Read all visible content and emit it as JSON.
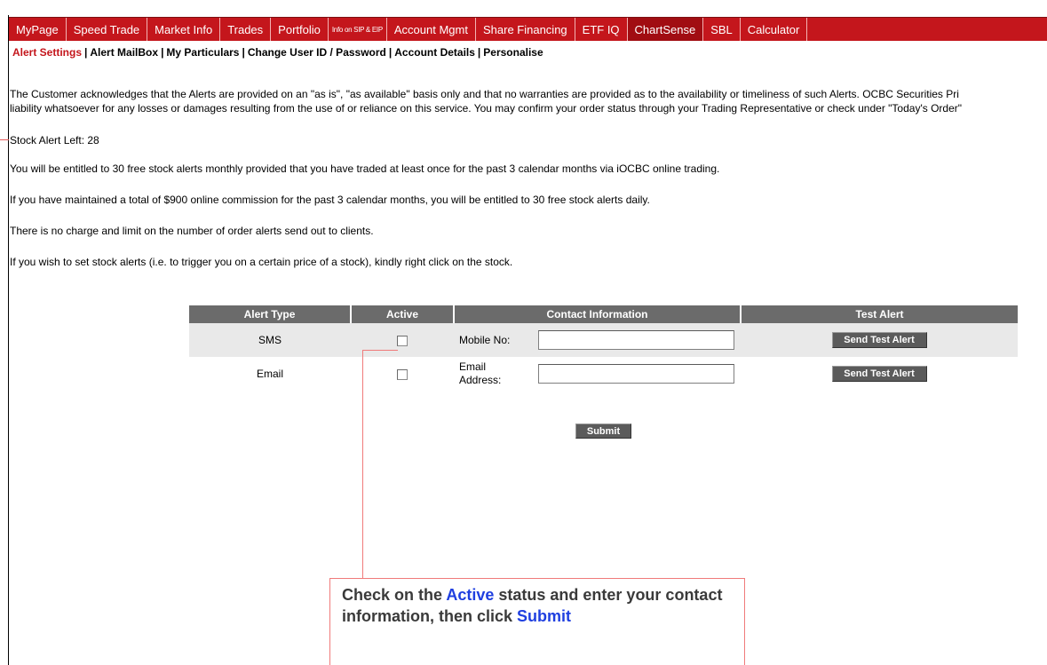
{
  "topnav": [
    {
      "label": "MyPage",
      "style": "normal"
    },
    {
      "label": "Speed Trade",
      "style": "normal"
    },
    {
      "label": "Market Info",
      "style": "normal"
    },
    {
      "label": "Trades",
      "style": "normal"
    },
    {
      "label": "Portfolio",
      "style": "normal"
    },
    {
      "label": "Info on SIP & EIP",
      "style": "tiny"
    },
    {
      "label": "Account Mgmt",
      "style": "normal"
    },
    {
      "label": "Share Financing",
      "style": "normal"
    },
    {
      "label": "ETF IQ",
      "style": "normal"
    },
    {
      "label": "ChartSense",
      "style": "dark"
    },
    {
      "label": "SBL",
      "style": "normal"
    },
    {
      "label": "Calculator",
      "style": "normal"
    }
  ],
  "subnav": [
    {
      "label": "Alert Settings",
      "active": true
    },
    {
      "label": "Alert MailBox",
      "active": false
    },
    {
      "label": "My Particulars",
      "active": false
    },
    {
      "label": "Change User ID / Password",
      "active": false
    },
    {
      "label": "Account Details",
      "active": false
    },
    {
      "label": "Personalise",
      "active": false
    }
  ],
  "subnav_separator": "|",
  "disclaimer": {
    "line1": "The Customer acknowledges that the Alerts are provided on an \"as is\", \"as available\" basis only and that no warranties are provided as to the availability or timeliness of such Alerts. OCBC Securities Pri",
    "line2": "liability whatsoever for any losses or damages resulting from the use of or reliance on this service. You may confirm your order status through your Trading Representative or check under \"Today's Order\""
  },
  "stock_alert_left": "Stock Alert Left: 28",
  "info": {
    "monthly": "You will be entitled to 30 free stock alerts monthly provided that you have traded at least once for the past 3 calendar months via iOCBC online trading.",
    "daily": "If you have maintained a total of $900 online commission for the past 3 calendar months, you will be entitled to 30 free stock alerts daily.",
    "order_alerts": "There is no charge and limit on the number of order alerts send out to clients.",
    "right_click": "If you wish to set stock alerts (i.e. to trigger you on a certain price of a stock), kindly right click on the stock."
  },
  "alerts_table": {
    "headers": {
      "alert_type": "Alert Type",
      "active": "Active",
      "contact": "Contact Information",
      "test": "Test Alert"
    },
    "rows": {
      "sms": {
        "type": "SMS",
        "active": false,
        "contact_label": "Mobile No:",
        "contact_value": "",
        "test_button": "Send Test Alert"
      },
      "email": {
        "type": "Email",
        "active": false,
        "contact_label_1": "Email",
        "contact_label_2": "Address:",
        "contact_value": "",
        "test_button": "Send Test Alert"
      }
    },
    "submit_label": "Submit"
  },
  "callout": {
    "part1": "Check on the ",
    "highlight1": "Active",
    "part2": " status and enter your contact information, then click ",
    "highlight2": "Submit"
  },
  "colors": {
    "brand_red": "#c4161c",
    "header_gray": "#6b6b6b",
    "row_gray": "#e9e9e9",
    "callout_border": "#f07a7a",
    "callout_highlight": "#1f3fe0"
  }
}
